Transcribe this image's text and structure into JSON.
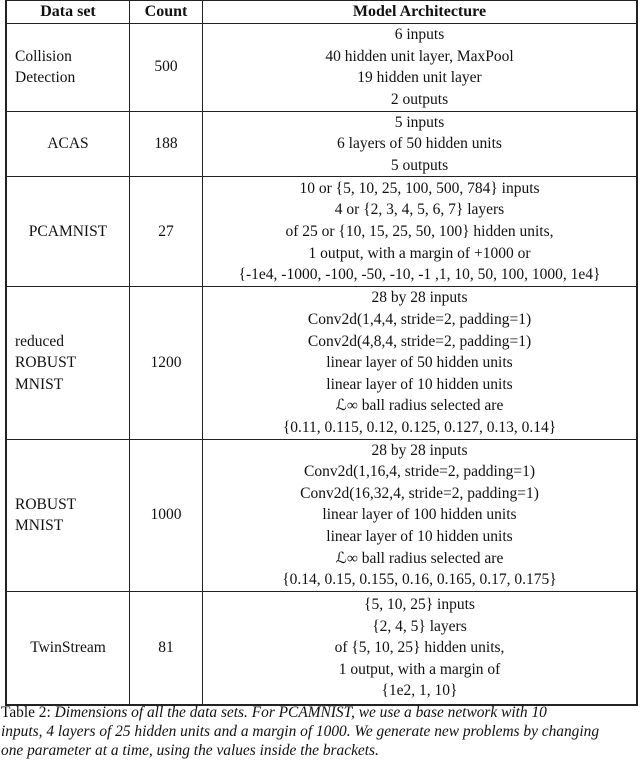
{
  "table": {
    "headers": [
      "Data set",
      "Count",
      "Model Architecture"
    ],
    "rows": [
      {
        "dataset": [
          "Collision",
          "Detection"
        ],
        "count": "500",
        "architecture": [
          "6 inputs",
          "40 hidden unit layer, MaxPool",
          "19 hidden unit layer",
          "2 outputs"
        ]
      },
      {
        "dataset": [
          "ACAS"
        ],
        "count": "188",
        "architecture": [
          "5 inputs",
          "6 layers of 50 hidden units",
          "5 outputs"
        ]
      },
      {
        "dataset": [
          "PCAMNIST"
        ],
        "count": "27",
        "architecture": [
          "10 or {5, 10, 25, 100, 500, 784} inputs",
          "4 or {2, 3, 4, 5, 6, 7} layers",
          "of 25 or {10, 15, 25, 50, 100} hidden units,",
          "1 output, with a margin of +1000 or",
          "{-1e4, -1000, -100, -50, -10, -1 ,1, 10, 50, 100, 1000, 1e4}"
        ]
      },
      {
        "dataset": [
          "reduced",
          "ROBUST",
          "MNIST"
        ],
        "count": "1200",
        "architecture": [
          "28 by 28 inputs",
          "Conv2d(1,4,4, stride=2, padding=1)",
          "Conv2d(4,8,4, stride=2, padding=1)",
          "linear layer of 50 hidden units",
          "linear layer of 10 hidden units",
          "ℒ∞ ball radius selected are",
          "{0.11, 0.115, 0.12, 0.125, 0.127, 0.13, 0.14}"
        ]
      },
      {
        "dataset": [
          "ROBUST",
          "MNIST"
        ],
        "count": "1000",
        "architecture": [
          "28 by 28 inputs",
          "Conv2d(1,16,4, stride=2, padding=1)",
          "Conv2d(16,32,4, stride=2, padding=1)",
          "linear layer of 100 hidden units",
          "linear layer of 10 hidden units",
          "ℒ∞ ball radius selected are",
          "{0.14, 0.15, 0.155, 0.16, 0.165, 0.17, 0.175}"
        ]
      },
      {
        "dataset": [
          "TwinStream"
        ],
        "count": "81",
        "architecture": [
          "{5, 10, 25} inputs",
          "{2, 4, 5} layers",
          "of {5, 10, 25} hidden units,",
          "1 output, with a margin of",
          "{1e2, 1, 10}"
        ]
      }
    ]
  },
  "caption": {
    "label": "Table 2:",
    "lines": [
      "Dimensions of all the data sets.  For PCAMNIST, we use a base network with 10",
      "inputs, 4 layers of 25 hidden units and a margin of 1000.  We generate new problems by changing",
      "one parameter at a time, using the values inside the brackets."
    ]
  }
}
